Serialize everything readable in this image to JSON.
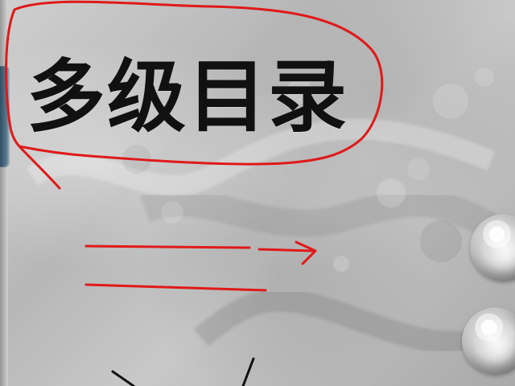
{
  "title": "多级目录",
  "colors": {
    "annotation": "#e01919",
    "text": "#111111",
    "panel_accent": "#45667f"
  },
  "icons": {
    "round_button_top": "glass-orb-icon",
    "round_button_bottom": "glass-orb-icon"
  }
}
